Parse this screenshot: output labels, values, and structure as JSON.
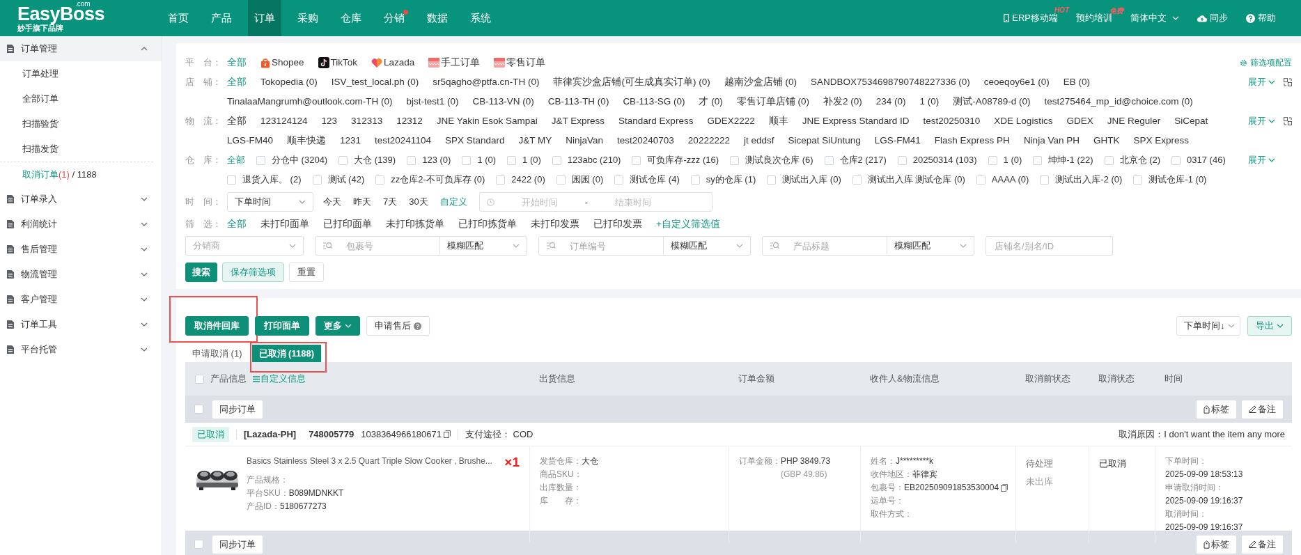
{
  "logo": {
    "name": "EasyBoss",
    "domain": ".com",
    "tagline": "妙手旗下品牌"
  },
  "nav": [
    {
      "label": "首页",
      "selected": false,
      "dot": false
    },
    {
      "label": "产品",
      "selected": false,
      "dot": false
    },
    {
      "label": "订单",
      "selected": true,
      "dot": false
    },
    {
      "label": "采购",
      "selected": false,
      "dot": false
    },
    {
      "label": "仓库",
      "selected": false,
      "dot": false
    },
    {
      "label": "分销",
      "selected": false,
      "dot": true
    },
    {
      "label": "数据",
      "selected": false,
      "dot": false
    },
    {
      "label": "系统",
      "selected": false,
      "dot": false
    }
  ],
  "top_right": [
    {
      "kind": "mobile",
      "label": "ERP移动端",
      "badge": "HOT"
    },
    {
      "kind": "plain",
      "label": "预约培训",
      "badge": "免费"
    },
    {
      "kind": "dropdown",
      "label": "简体中文"
    },
    {
      "kind": "sync",
      "label": "同步"
    },
    {
      "kind": "help",
      "label": "帮助"
    }
  ],
  "sidebar": [
    {
      "label": "订单管理",
      "expanded": true,
      "children": [
        {
          "label": "订单处理",
          "selected": false
        },
        {
          "label": "全部订单",
          "selected": false
        },
        {
          "label": "扫描验货",
          "selected": false
        },
        {
          "label": "扫描发货",
          "selected": false
        },
        {
          "label": "取消订单",
          "count": "(1)",
          "total": "/ 1188",
          "selected": true
        }
      ]
    },
    {
      "label": "订单录入",
      "expanded": false
    },
    {
      "label": "利润统计",
      "expanded": false
    },
    {
      "label": "售后管理",
      "expanded": false
    },
    {
      "label": "物流管理",
      "expanded": false
    },
    {
      "label": "客户管理",
      "expanded": false
    },
    {
      "label": "订单工具",
      "expanded": false
    },
    {
      "label": "平台托管",
      "expanded": false
    }
  ],
  "filters": {
    "config_link": "筛选项配置",
    "platform": {
      "label": "平　台：",
      "options": [
        {
          "label": "全部",
          "kind": "all",
          "selected": true
        },
        {
          "label": "Shopee",
          "kind": "shopee",
          "selected": false
        },
        {
          "label": "TikTok",
          "kind": "tiktok",
          "selected": false
        },
        {
          "label": "Lazada",
          "kind": "lazada",
          "selected": false
        },
        {
          "label": "手工订单",
          "kind": "manual",
          "selected": false
        },
        {
          "label": "零售订单",
          "kind": "manual",
          "selected": false
        }
      ]
    },
    "store": {
      "label": "店　铺：",
      "expand": "展开",
      "options": [
        {
          "label": "全部",
          "selected": true
        },
        {
          "label": "Tokopedia (0)",
          "selected": false
        },
        {
          "label": "ISV_test_local.ph (0)",
          "selected": false
        },
        {
          "label": "sr5qagho@ptfa.cn-TH (0)",
          "selected": false
        },
        {
          "label": "菲律宾沙盒店铺(可生成真实订单) (0)",
          "selected": false
        },
        {
          "label": "越南沙盒店铺 (0)",
          "selected": false
        },
        {
          "label": "SANDBOX7534698790748227336 (0)",
          "selected": false
        },
        {
          "label": "ceoeqoy6e1 (0)",
          "selected": false
        },
        {
          "label": "EB (0)",
          "selected": false
        },
        {
          "label": "TinalaaMangrumh@outlook.com-TH (0)",
          "selected": false
        },
        {
          "label": "bjst-test1 (0)",
          "selected": false
        },
        {
          "label": "CB-113-VN (0)",
          "selected": false
        },
        {
          "label": "CB-113-TH (0)",
          "selected": false
        },
        {
          "label": "CB-113-SG (0)",
          "selected": false
        },
        {
          "label": "才 (0)",
          "selected": false
        },
        {
          "label": "零售订单店铺 (0)",
          "selected": false
        },
        {
          "label": "补发2 (0)",
          "selected": false
        },
        {
          "label": "234 (0)",
          "selected": false
        },
        {
          "label": "1 (0)",
          "selected": false
        },
        {
          "label": "测试-A08789-d (0)",
          "selected": false
        },
        {
          "label": "test275464_mp_id@choice.com (0)",
          "selected": false
        }
      ]
    },
    "logistics": {
      "label": "物　流：",
      "expand": "展开",
      "options": [
        {
          "label": "全部",
          "selected": false
        },
        {
          "label": "123124124",
          "selected": false
        },
        {
          "label": "123",
          "selected": false
        },
        {
          "label": "312313",
          "selected": false
        },
        {
          "label": "12312",
          "selected": false
        },
        {
          "label": "JNE Yakin Esok Sampai",
          "selected": false
        },
        {
          "label": "J&T Express",
          "selected": false
        },
        {
          "label": "Standard Express",
          "selected": false
        },
        {
          "label": "GDEX2222",
          "selected": false
        },
        {
          "label": "顺丰",
          "selected": false
        },
        {
          "label": "JNE Express Standard ID",
          "selected": false
        },
        {
          "label": "test20250310",
          "selected": false
        },
        {
          "label": "XDE Logistics",
          "selected": false
        },
        {
          "label": "GDEX",
          "selected": false
        },
        {
          "label": "JNE Reguler",
          "selected": false
        },
        {
          "label": "SiCepat",
          "selected": false
        },
        {
          "label": "LGS-FM40",
          "selected": false
        },
        {
          "label": "顺丰快递",
          "selected": false
        },
        {
          "label": "1231",
          "selected": false
        },
        {
          "label": "test20241104",
          "selected": false
        },
        {
          "label": "SPX Standard",
          "selected": false
        },
        {
          "label": "J&T MY",
          "selected": false
        },
        {
          "label": "NinjaVan",
          "selected": false
        },
        {
          "label": "test20240703",
          "selected": false
        },
        {
          "label": "20222222",
          "selected": false
        },
        {
          "label": "jt eddsf",
          "selected": false
        },
        {
          "label": "Sicepat SiUntung",
          "selected": false
        },
        {
          "label": "LGS-FM41",
          "selected": false
        },
        {
          "label": "Flash Express PH",
          "selected": false
        },
        {
          "label": "Ninja Van PH",
          "selected": false
        },
        {
          "label": "GHTK",
          "selected": false
        },
        {
          "label": "SPX Express",
          "selected": false
        }
      ]
    },
    "warehouse": {
      "label": "仓　库：",
      "expand": "展开",
      "all": {
        "label": "全部",
        "selected": true
      },
      "options": [
        {
          "label": "分仓中 (3204)",
          "checked": false
        },
        {
          "label": "大仓 (139)",
          "checked": false
        },
        {
          "label": "123 (0)",
          "checked": false
        },
        {
          "label": "1 (0)",
          "checked": false
        },
        {
          "label": "1 (0)",
          "checked": false
        },
        {
          "label": "123abc (210)",
          "checked": false
        },
        {
          "label": "可负库存-zzz (16)",
          "checked": false
        },
        {
          "label": "测试良次仓库 (6)",
          "checked": false
        },
        {
          "label": "仓库2 (217)",
          "checked": false
        },
        {
          "label": "20250314 (103)",
          "checked": false
        },
        {
          "label": "1 (0)",
          "checked": false
        },
        {
          "label": "坤坤-1 (22)",
          "checked": false
        },
        {
          "label": "北京仓 (2)",
          "checked": false
        },
        {
          "label": "0317 (46)",
          "checked": false
        },
        {
          "label": "退货入库。 (2)",
          "checked": false
        },
        {
          "label": "测试 (42)",
          "checked": false
        },
        {
          "label": "zz仓库2-不可负库存 (0)",
          "checked": false
        },
        {
          "label": "2422 (0)",
          "checked": false
        },
        {
          "label": "囷囷 (0)",
          "checked": false
        },
        {
          "label": "测试仓库 (4)",
          "checked": false
        },
        {
          "label": "sy的仓库 (1)",
          "checked": false
        },
        {
          "label": "测试出入库 (0)",
          "checked": false
        },
        {
          "label": "测试出入库 测试仓库 (0)",
          "checked": false
        },
        {
          "label": "AAAA (0)",
          "checked": false
        },
        {
          "label": "测试出入库-2 (0)",
          "checked": false
        },
        {
          "label": "测试仓库-1 (0)",
          "checked": false
        }
      ]
    },
    "time": {
      "label": "时　间：",
      "select": "下单时间",
      "quick": [
        "今天",
        "昨天",
        "7天",
        "30天"
      ],
      "custom_link": "自定义",
      "start_placeholder": "开始时间",
      "separator": "-",
      "end_placeholder": "结束时间"
    },
    "screen": {
      "label": "筛　选：",
      "custom_link": "+自定义筛选值",
      "options": [
        {
          "label": "全部",
          "selected": true
        },
        {
          "label": "未打印面单",
          "selected": false
        },
        {
          "label": "已打印面单",
          "selected": false
        },
        {
          "label": "未打印拣货单",
          "selected": false
        },
        {
          "label": "已打印拣货单",
          "selected": false
        },
        {
          "label": "未打印发票",
          "selected": false
        },
        {
          "label": "已打印发票",
          "selected": false
        }
      ]
    },
    "search_fields": [
      {
        "kind": "select",
        "placeholder": "分销商"
      },
      {
        "kind": "combo",
        "placeholder": "包裹号",
        "match": "模糊匹配"
      },
      {
        "kind": "combo",
        "placeholder": "订单编号",
        "match": "模糊匹配"
      },
      {
        "kind": "combo",
        "placeholder": "产品标题",
        "match": "模糊匹配"
      },
      {
        "kind": "input",
        "placeholder": "店铺名/别名/ID"
      }
    ],
    "buttons": [
      {
        "label": "搜索",
        "kind": "primary"
      },
      {
        "label": "保存筛选项",
        "kind": "light"
      },
      {
        "label": "重置",
        "kind": "plain"
      }
    ]
  },
  "actions": [
    {
      "label": "取消件回库",
      "kind": "primary",
      "highlighted": true
    },
    {
      "label": "打印面单",
      "kind": "primary",
      "highlighted": false
    },
    {
      "label": "更多",
      "kind": "dropdown",
      "highlighted": false
    },
    {
      "label": "申请售后",
      "kind": "help",
      "highlighted": false
    }
  ],
  "sort_select": "下单时间↓",
  "export": "导出",
  "tabs": [
    {
      "label": "申请取消 (1)",
      "selected": false,
      "highlighted": false
    },
    {
      "label": "已取消 (1188)",
      "selected": true,
      "highlighted": true
    }
  ],
  "table": {
    "select_all_checked": false,
    "custom_info_link": "自定义信息",
    "columns": [
      "产品信息",
      "出货信息",
      "订单金额",
      "收件人&物流信息",
      "取消前状态",
      "取消状态",
      "时间"
    ]
  },
  "orders": [
    {
      "checked": false,
      "sync": "同步订单",
      "tag": "标签",
      "note": "备注",
      "status_tag": "已取消",
      "platform": "[Lazada-PH]",
      "order_no": "748005779",
      "platform_order_no": "1038364966180671",
      "payment_label": "支付途径：",
      "payment": "COD",
      "cancel_reason_label": "取消原因：",
      "cancel_reason": "I don't want the item any more",
      "product": {
        "title": "Basics Stainless Steel 3 x 2.5 Quart Triple Slow Cooker , Brushe...",
        "quantity": "×1",
        "fields": [
          {
            "label": "产品规格："
          },
          {
            "label": "平台SKU：",
            "value": "B089MDNKKT"
          },
          {
            "label": "产品ID：",
            "value": "5180677273"
          }
        ]
      },
      "shipping": [
        {
          "label": "发货仓库：",
          "value": "大仓"
        },
        {
          "label": "商品SKU："
        },
        {
          "label": "出库数量："
        },
        {
          "label": "库　　存："
        }
      ],
      "amount": {
        "label": "订单金额：",
        "value": "PHP 3849.73",
        "converted": "(GBP 49.86)"
      },
      "recipient": [
        {
          "label": "姓名：",
          "value": "J*********k"
        },
        {
          "label": "收件地区：",
          "value": "菲律宾"
        },
        {
          "label": "包裹号：",
          "value": "EB202509091853530004",
          "copyable": true
        },
        {
          "label": "运单号："
        },
        {
          "label": "取件方式："
        }
      ],
      "pre_status": [
        "待处理",
        "未出库"
      ],
      "cancel_status": "已取消",
      "times": [
        {
          "label": "下单时间：",
          "value": "2025-09-09 18:53:13"
        },
        {
          "label": "申请取消时间：",
          "value": "2025-09-09 19:16:37"
        },
        {
          "label": "取消时间：",
          "value": "2025-09-09 19:16:37"
        }
      ]
    },
    {
      "checked": false,
      "sync": "同步订单",
      "tag": "标签",
      "note": "备注"
    }
  ]
}
